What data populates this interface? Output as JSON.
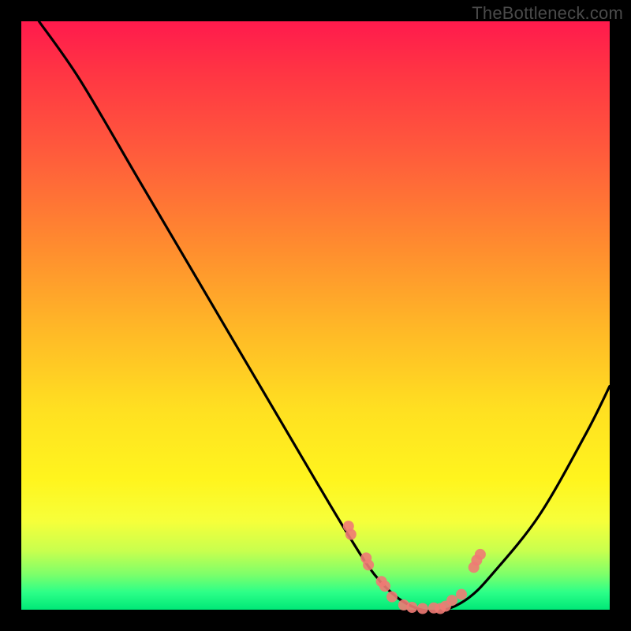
{
  "watermark": "TheBottleneck.com",
  "colors": {
    "background": "#000000",
    "curve": "#000000",
    "marker": "#ef7a74",
    "gradient_stops": [
      "#ff1a4d",
      "#ff5a3c",
      "#ffb727",
      "#fff51e",
      "#7dff6a",
      "#00e877"
    ]
  },
  "chart_data": {
    "type": "line",
    "title": "",
    "xlabel": "",
    "ylabel": "",
    "xlim": [
      0,
      100
    ],
    "ylim": [
      0,
      100
    ],
    "note": "No numeric axes shown; values are normalized 0–100 estimates of the visible curve (y=0 at bottom).",
    "series": [
      {
        "name": "bottleneck-curve",
        "x": [
          3,
          10,
          20,
          30,
          40,
          50,
          56,
          60,
          64,
          68,
          72,
          76,
          80,
          88,
          96,
          100
        ],
        "y": [
          100,
          90,
          73,
          56,
          39,
          22,
          12,
          6,
          2,
          0,
          0,
          2,
          6,
          16,
          30,
          38
        ]
      }
    ],
    "markers": {
      "name": "highlight-points",
      "note": "Pink dots clustered near the curve minimum",
      "x": [
        55.6,
        56.0,
        58.6,
        59.0,
        61.2,
        61.8,
        63.0,
        65.0,
        66.4,
        68.2,
        70.1,
        71.2,
        72.1,
        73.2,
        74.8,
        76.9,
        77.4,
        78.0
      ],
      "y": [
        14.2,
        12.8,
        8.8,
        7.6,
        4.8,
        4.0,
        2.2,
        0.8,
        0.4,
        0.2,
        0.3,
        0.2,
        0.6,
        1.6,
        2.6,
        7.2,
        8.4,
        9.4
      ]
    }
  }
}
